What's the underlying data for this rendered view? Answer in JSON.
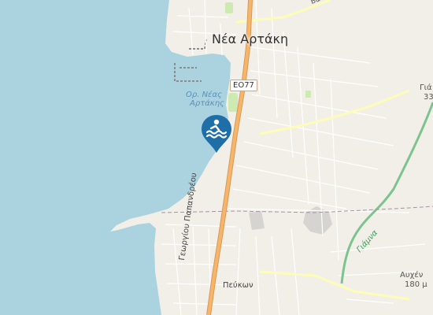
{
  "map": {
    "town_label": "Νέα Αρτάκη",
    "water_label_line1": "Ορ. Νέας",
    "water_label_line2": "Αρτάκης",
    "road_badge": "ΕΟ77",
    "edge_label_right_top_1": "Γιά",
    "edge_label_right_top_2": "33",
    "edge_label_right_bottom_1": "Αυχέν",
    "edge_label_right_bottom_2": "180 μ",
    "road_top_fragment": "Βα",
    "street_main": "Γεωργίου Παπανδρέου",
    "street_small": "Πεύκων",
    "river_label": "Γιάμνα"
  },
  "marker": {
    "icon": "swimming-icon",
    "color": "#1e6ea8"
  },
  "colors": {
    "sea": "#aad3df",
    "land": "#f2efe9",
    "main_road": "#f7b46b",
    "river": "#7cc48e"
  }
}
